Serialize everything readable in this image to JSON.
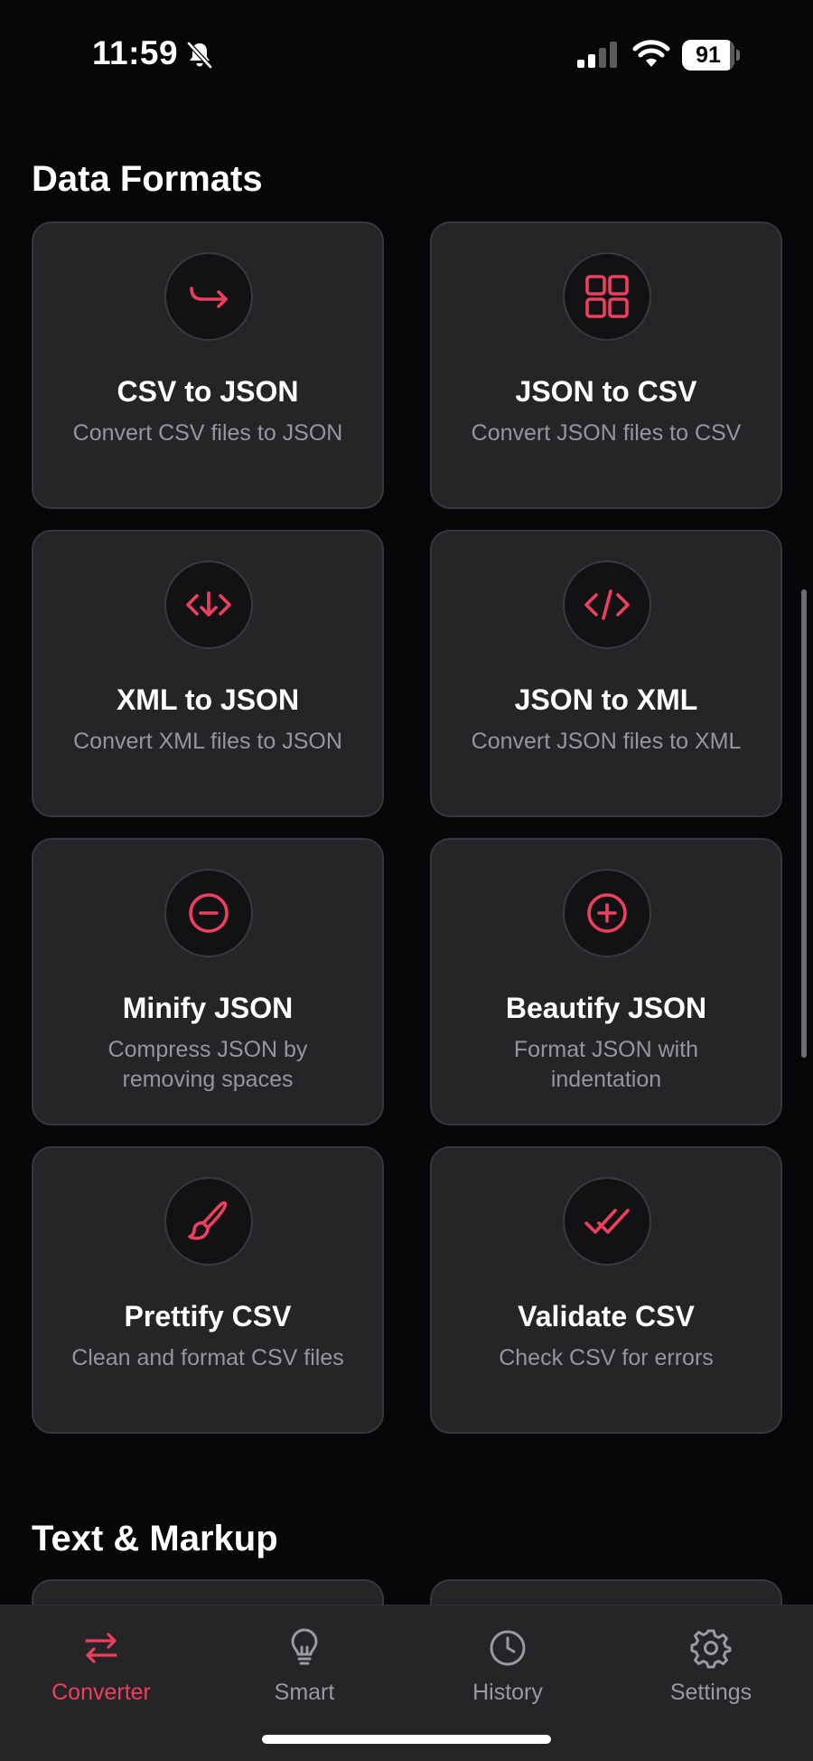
{
  "status_bar": {
    "time": "11:59",
    "battery_level": 91,
    "battery_label": "91"
  },
  "accent_color": "#ee3f5e",
  "sections": [
    {
      "title": "Data Formats",
      "cards": [
        {
          "title": "CSV to JSON",
          "description": "Convert CSV files to JSON",
          "icon": "arrow-hook-right-icon"
        },
        {
          "title": "JSON to CSV",
          "description": "Convert JSON files to CSV",
          "icon": "grid-icon"
        },
        {
          "title": "XML to JSON",
          "description": "Convert XML files to JSON",
          "icon": "code-download-icon"
        },
        {
          "title": "JSON to XML",
          "description": "Convert JSON files to XML",
          "icon": "code-icon"
        },
        {
          "title": "Minify JSON",
          "description": "Compress JSON by removing spaces",
          "icon": "minus-circle-icon"
        },
        {
          "title": "Beautify JSON",
          "description": "Format JSON with indentation",
          "icon": "plus-circle-icon"
        },
        {
          "title": "Prettify CSV",
          "description": "Clean and format CSV files",
          "icon": "brush-icon"
        },
        {
          "title": "Validate CSV",
          "description": "Check CSV for errors",
          "icon": "double-check-icon"
        }
      ]
    },
    {
      "title": "Text & Markup"
    }
  ],
  "tab_bar": {
    "tabs": [
      {
        "label": "Converter",
        "icon": "swap-arrows-icon",
        "active": true
      },
      {
        "label": "Smart",
        "icon": "lightbulb-icon",
        "active": false
      },
      {
        "label": "History",
        "icon": "clock-icon",
        "active": false
      },
      {
        "label": "Settings",
        "icon": "gear-icon",
        "active": false
      }
    ]
  }
}
